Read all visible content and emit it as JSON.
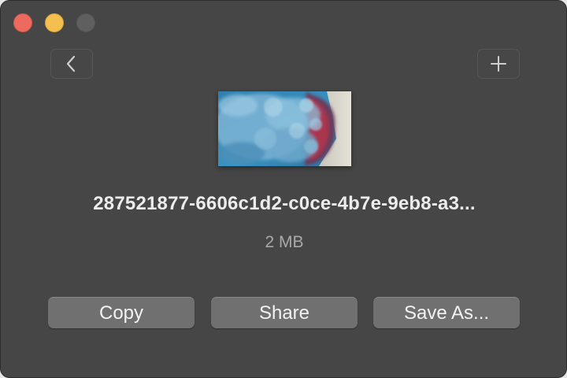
{
  "window": {
    "traffic_lights": [
      {
        "name": "close",
        "color": "#ed6a5e"
      },
      {
        "name": "minimize",
        "color": "#f5bf4f"
      },
      {
        "name": "zoom",
        "color": "#5f5f5f"
      }
    ]
  },
  "toolbar": {
    "back_icon": "chevron-left-icon",
    "add_icon": "plus-icon"
  },
  "file": {
    "thumbnail": "blue-smoke-image",
    "name": "287521877-6606c1d2-c0ce-4b7e-9eb8-a3...",
    "size": "2 MB"
  },
  "actions": {
    "copy_label": "Copy",
    "share_label": "Share",
    "save_as_label": "Save As..."
  }
}
